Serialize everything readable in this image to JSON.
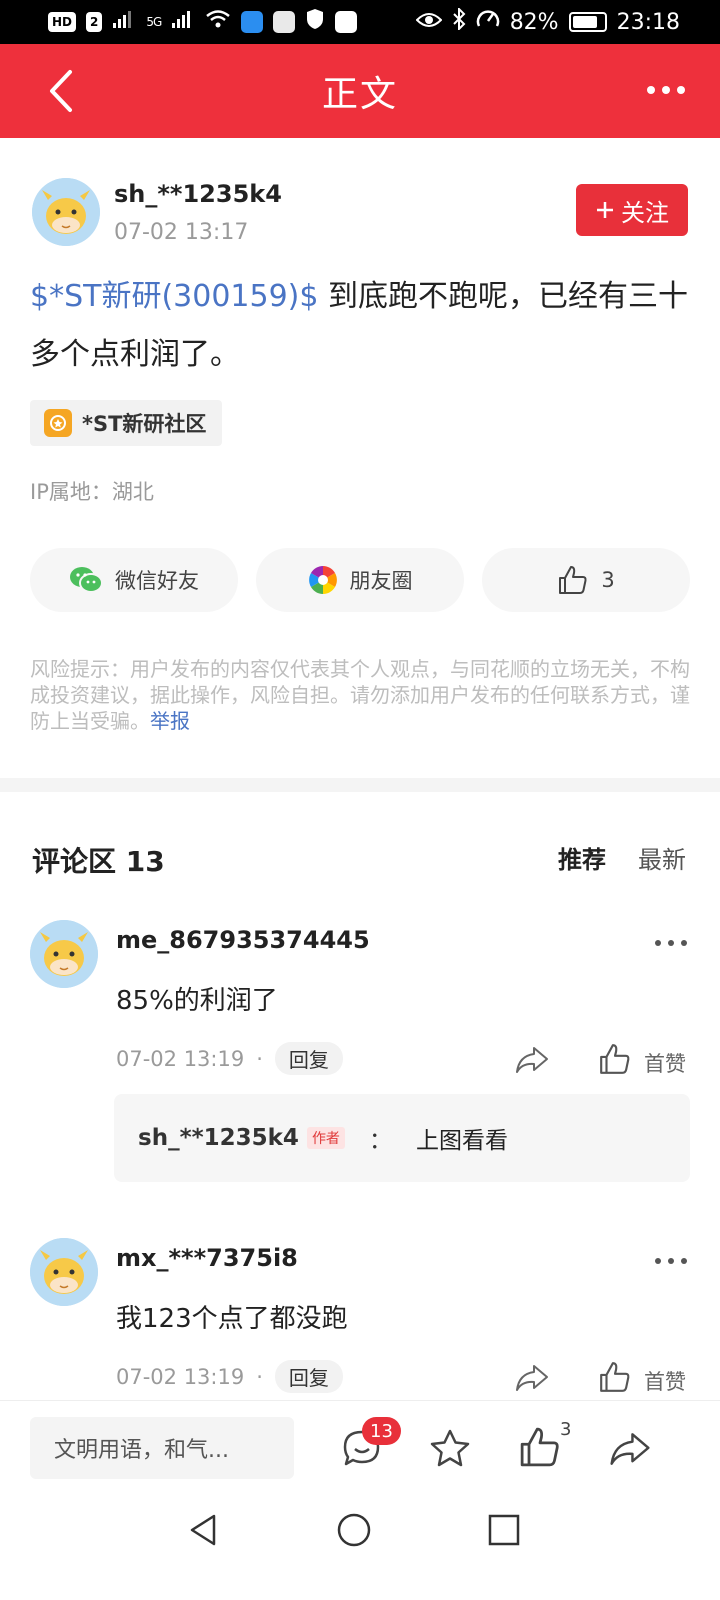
{
  "status_bar": {
    "network_badges": [
      "HD",
      "2"
    ],
    "signal_label": "5G",
    "battery": "82%",
    "battery_level": 0.82,
    "time": "23:18"
  },
  "header": {
    "title": "正文"
  },
  "post": {
    "username": "sh_**1235k4",
    "time": "07-02 13:17",
    "follow_label": "关注",
    "stock_tag": "$*ST新研(300159)$",
    "content": " 到底跑不跑呢，已经有三十多个点利润了。",
    "community_tag": "*ST新研社区",
    "ip_location": "IP属地：湖北",
    "share": {
      "wechat_label": "微信好友",
      "moments_label": "朋友圈",
      "like_count": "3"
    },
    "risk_notice": "风险提示：用户发布的内容仅代表其个人观点，与同花顺的立场无关，不构成投资建议，据此操作，风险自担。请勿添加用户发布的任何联系方式，谨防上当受骗。",
    "report_label": "举报"
  },
  "comments": {
    "title": "评论区 13",
    "sort_recommended": "推荐",
    "sort_latest": "最新",
    "items": [
      {
        "username": "me_867935374445",
        "text": "85%的利润了",
        "time": "07-02 13:19",
        "dot": "·",
        "reply_label": "回复",
        "like_label": "首赞",
        "reply": {
          "username": "sh_**1235k4",
          "author_tag": "作者",
          "colon": "：",
          "text": "上图看看"
        }
      },
      {
        "username": "mx_***7375i8",
        "text": "我123个点了都没跑",
        "time": "07-02 13:19",
        "dot": "·",
        "reply_label": "回复",
        "like_label": "首赞"
      }
    ]
  },
  "bottom_bar": {
    "input_placeholder": "文明用语，和气...",
    "comment_count": "13",
    "like_count": "3"
  },
  "colors": {
    "brand_red": "#ee303c",
    "link_blue": "#4a74c4",
    "avatar_bg": "#b9dcf4"
  },
  "icons": [
    "back-arrow-icon",
    "more-icon",
    "wechat-icon",
    "moments-icon",
    "thumbs-up-icon",
    "share-icon",
    "comment-icon",
    "star-icon",
    "nav-back-icon",
    "nav-home-icon",
    "nav-recents-icon"
  ]
}
